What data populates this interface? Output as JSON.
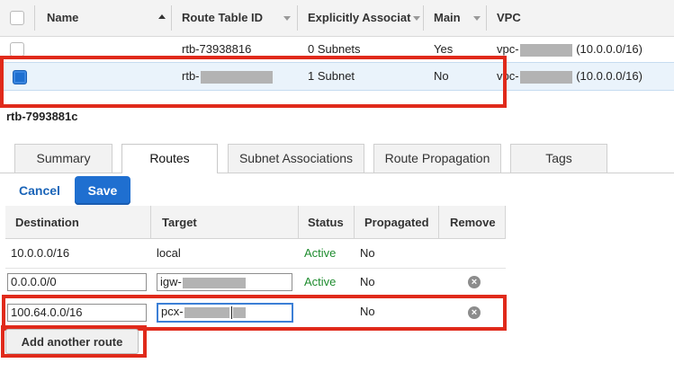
{
  "route_table_list": {
    "columns": [
      "Name",
      "Route Table ID",
      "Explicitly Associat",
      "Main",
      "VPC"
    ],
    "rows": [
      {
        "name": "",
        "route_table_id": "rtb-73938816",
        "explicit": "0 Subnets",
        "main": "Yes",
        "vpc_prefix": "vpc-",
        "vpc_cidr": "(10.0.0.0/16)",
        "selected": false
      },
      {
        "name": "",
        "route_table_id": "rtb-",
        "explicit": "1 Subnet",
        "main": "No",
        "vpc_prefix": "vpc-",
        "vpc_cidr": "(10.0.0.0/16)",
        "selected": true
      }
    ]
  },
  "detail": {
    "selected_id": "rtb-7993881c",
    "tabs": [
      "Summary",
      "Routes",
      "Subnet Associations",
      "Route Propagation",
      "Tags"
    ],
    "active_tab": "Routes",
    "cancel_label": "Cancel",
    "save_label": "Save",
    "routes_columns": [
      "Destination",
      "Target",
      "Status",
      "Propagated",
      "Remove"
    ],
    "routes": [
      {
        "destination": "10.0.0.0/16",
        "target": "local",
        "status": "Active",
        "propagated": "No",
        "editable": false
      },
      {
        "destination": "0.0.0.0/0",
        "target": "igw-",
        "status": "Active",
        "propagated": "No",
        "editable": true
      },
      {
        "destination": "100.64.0.0/16",
        "target": "pcx-",
        "status": "",
        "propagated": "No",
        "editable": true
      }
    ],
    "add_route_label": "Add another route"
  },
  "colors": {
    "accent_blue": "#1f6fd0",
    "active_green": "#1f8c2f",
    "highlight_red": "#e02a1b"
  }
}
